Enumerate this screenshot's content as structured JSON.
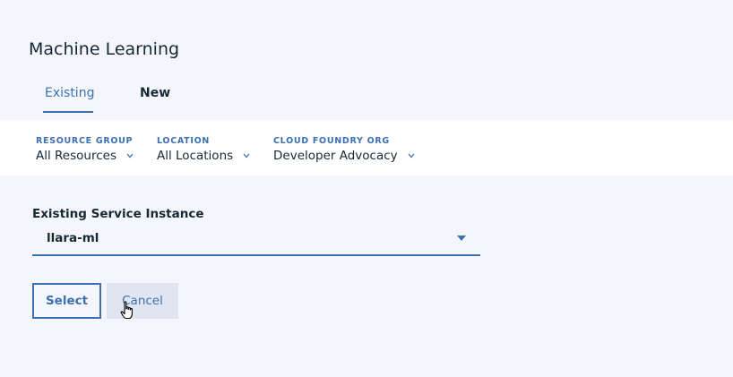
{
  "page": {
    "title": "Machine Learning"
  },
  "tabs": [
    {
      "label": "Existing",
      "selected": true
    },
    {
      "label": "New",
      "selected": false
    }
  ],
  "filters": {
    "resource_group": {
      "label": "RESOURCE GROUP",
      "value": "All Resources"
    },
    "location": {
      "label": "LOCATION",
      "value": "All Locations"
    },
    "cloud_foundry_org": {
      "label": "CLOUD FOUNDRY ORG",
      "value": "Developer Advocacy"
    }
  },
  "service_instance": {
    "label": "Existing Service Instance",
    "value": "llara-ml"
  },
  "actions": {
    "select_label": "Select",
    "cancel_label": "Cancel"
  },
  "colors": {
    "accent": "#3d70b2",
    "text": "#152935",
    "background": "#f4f6fb",
    "filter_bar": "#ffffff",
    "cancel_bg": "#dfe5f1"
  },
  "icons": {
    "filter_chevron": "chevron-down-icon",
    "select_caret": "caret-down-icon",
    "cursor": "hand-pointer-icon"
  }
}
